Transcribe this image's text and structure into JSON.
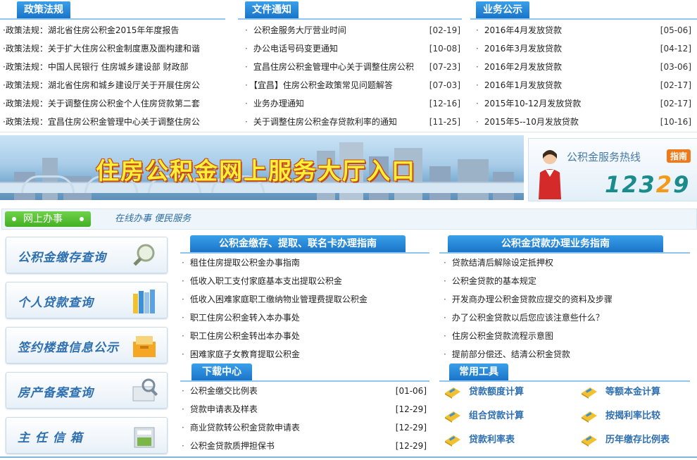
{
  "policy": {
    "tab": "政策法规",
    "items": [
      "·政策法规：湖北省住房公积金2015年年度报告",
      "·政策法规：关于扩大住房公积金制度惠及面构建和谐",
      "·政策法规：中国人民银行 住房城乡建设部 财政部",
      "·政策法规：湖北省住房和城乡建设厅关于开展住房公",
      "·政策法规：关于调整住房公积金个人住房贷款第二套",
      "·政策法规：宜昌住房公积金管理中心关于调整住房公"
    ]
  },
  "notices": {
    "tab": "文件通知",
    "items": [
      {
        "title": "公积金服务大厅营业时间",
        "date": "[02-19]"
      },
      {
        "title": "办公电话号码变更通知",
        "date": "[10-08]"
      },
      {
        "title": "宜昌住房公积金管理中心关于调整住房公积",
        "date": "[07-23]"
      },
      {
        "title": "【宜昌】住房公积金政策常见问题解答",
        "date": "[07-03]"
      },
      {
        "title": "业务办理通知",
        "date": "[12-16]"
      },
      {
        "title": "关于调整住房公积金存贷款利率的通知",
        "date": "[11-25]"
      }
    ]
  },
  "business": {
    "tab": "业务公示",
    "items": [
      {
        "title": "2016年4月发放贷款",
        "date": "[05-06]"
      },
      {
        "title": "2016年3月发放贷款",
        "date": "[04-12]"
      },
      {
        "title": "2016年2月发放贷款",
        "date": "[03-06]"
      },
      {
        "title": "2016年1月发放贷款",
        "date": "[02-17]"
      },
      {
        "title": "2015年10-12月发放贷款",
        "date": "[02-17]"
      },
      {
        "title": "2015年5--10月发放贷款",
        "date": "[10-16]"
      }
    ]
  },
  "banner": {
    "title": "住房公积金网上服务大厅入口"
  },
  "hotline": {
    "label": "公积金服务热线",
    "tag": "指南",
    "number_main": "123",
    "number_accent": "2",
    "number_tail": "9"
  },
  "online": {
    "tab": "网上办事",
    "links": "在线办事   便民服务"
  },
  "left_buttons": [
    {
      "label": "公积金缴存查询"
    },
    {
      "label": "个人贷款查询"
    },
    {
      "label": "签约楼盘信息公示"
    },
    {
      "label": "房产备案查询"
    },
    {
      "label": "主 任 信 箱"
    }
  ],
  "guide_withdraw": {
    "tab": "公积金缴存、提取、联名卡办理指南",
    "items": [
      "租住住房提取公积金办事指南",
      "低收入职工支付家庭基本支出提取公积金",
      "低收入困难家庭职工缴纳物业管理费提取公积金",
      "职工住房公积金转入本办事处",
      "职工住房公积金转出本办事处",
      "困难家庭子女教育提取公积金"
    ]
  },
  "guide_loan": {
    "tab": "公积金贷款办理业务指南",
    "items": [
      "贷款结清后解除设定抵押权",
      "公积金贷款的基本规定",
      "开发商办理公积金贷款应提交的资料及步骤",
      "办了公积金贷款以后您应该注意些什么？",
      "住房公积金贷款流程示意图",
      "提前部分偿还、结清公积金贷款"
    ]
  },
  "downloads": {
    "tab": "下载中心",
    "items": [
      {
        "title": "公积金缴交比例表",
        "date": "[01-06]"
      },
      {
        "title": "贷款申请表及样表",
        "date": "[12-29]"
      },
      {
        "title": "商业贷款转公积金贷款申请表",
        "date": "[12-29]"
      },
      {
        "title": "公积金贷款质押担保书",
        "date": "[12-29]"
      }
    ]
  },
  "tools": {
    "tab": "常用工具",
    "items": [
      {
        "label": "贷款额度计算"
      },
      {
        "label": "等额本金计算"
      },
      {
        "label": "组合贷款计算"
      },
      {
        "label": "按揭利率比较"
      },
      {
        "label": "贷款利率表"
      },
      {
        "label": "历年缴存比例表"
      }
    ]
  }
}
